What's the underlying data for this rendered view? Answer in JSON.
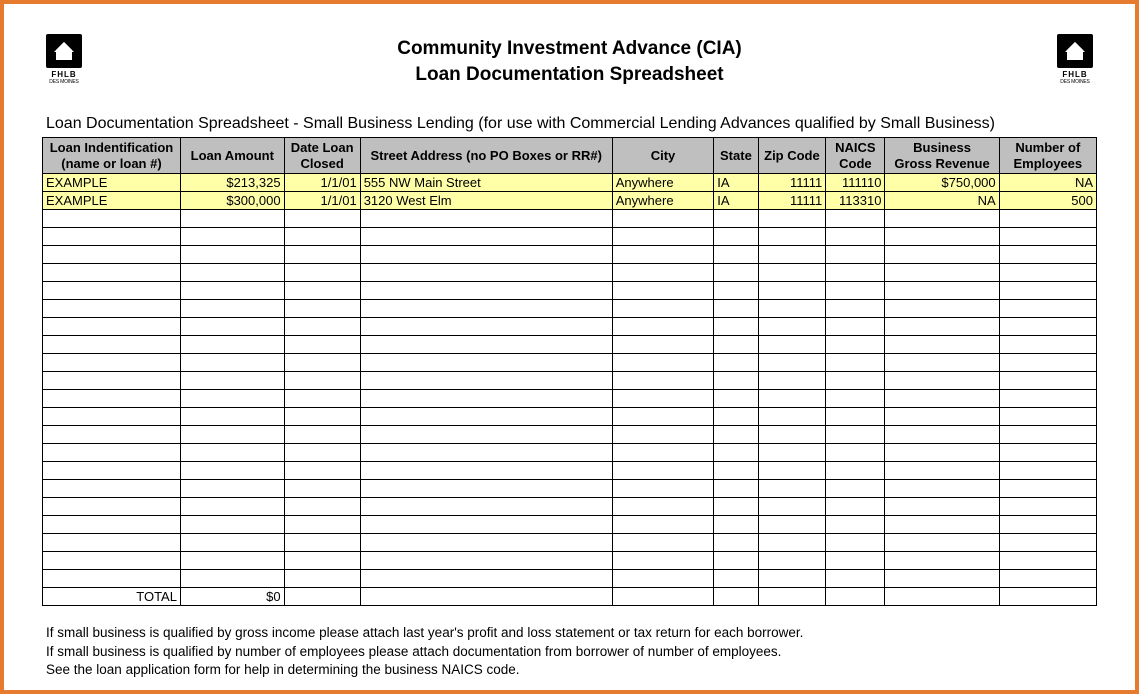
{
  "logo": {
    "name": "FHLB",
    "sub": "DES MOINES"
  },
  "title": {
    "line1": "Community Investment Advance (CIA)",
    "line2": "Loan Documentation Spreadsheet"
  },
  "subtitle": "Loan Documentation Spreadsheet - Small Business Lending (for use with Commercial Lending Advances qualified by Small Business)",
  "columns": [
    {
      "line1": "Loan Indentification",
      "line2": "(name or loan #)"
    },
    {
      "line1": "",
      "line2": "Loan Amount"
    },
    {
      "line1": "Date Loan",
      "line2": "Closed"
    },
    {
      "line1": "",
      "line2": "Street Address (no PO Boxes or RR#)"
    },
    {
      "line1": "",
      "line2": "City"
    },
    {
      "line1": "",
      "line2": "State"
    },
    {
      "line1": "",
      "line2": "Zip Code"
    },
    {
      "line1": "NAICS",
      "line2": "Code"
    },
    {
      "line1": "Business",
      "line2": "Gross Revenue"
    },
    {
      "line1": "Number of",
      "line2": "Employees"
    }
  ],
  "rows": [
    {
      "id": "EXAMPLE",
      "amt": "$213,325",
      "date": "1/1/01",
      "addr": "555 NW Main Street",
      "city": "Anywhere",
      "state": "IA",
      "zip": "11111",
      "naics": "111110",
      "rev": "$750,000",
      "emp": "NA"
    },
    {
      "id": "EXAMPLE",
      "amt": "$300,000",
      "date": "1/1/01",
      "addr": "3120 West Elm",
      "city": "Anywhere",
      "state": "IA",
      "zip": "11111",
      "naics": "113310",
      "rev": "NA",
      "emp": "500"
    }
  ],
  "emptyRows": 21,
  "total": {
    "label": "TOTAL",
    "amount": "$0"
  },
  "notes": [
    "If small business is qualified by gross income please attach last year's profit and loss statement or tax return for each borrower.",
    "If small business is qualified by number of employees please attach documentation from borrower of number of employees.",
    "See the loan application form for help in determining the business NAICS code."
  ]
}
